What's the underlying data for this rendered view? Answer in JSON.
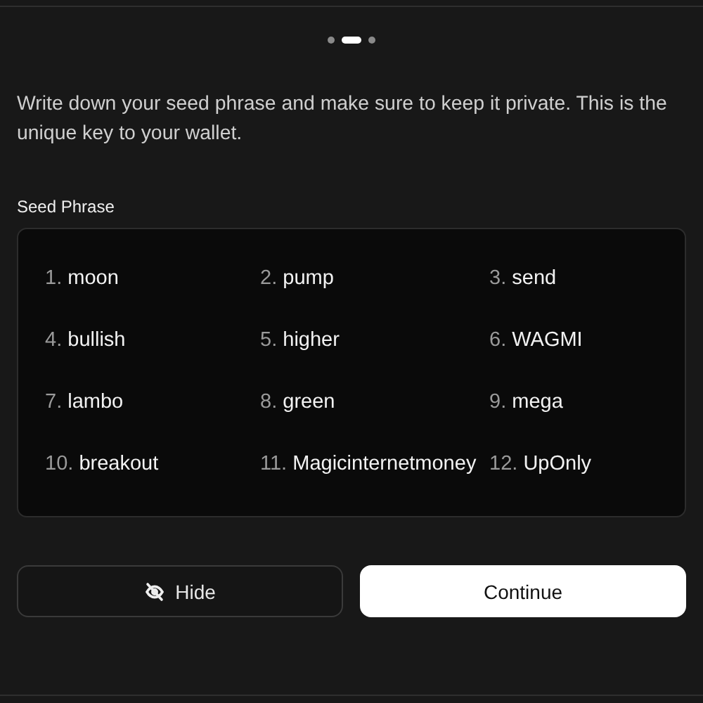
{
  "pager": [
    {
      "selected": false
    },
    {
      "selected": true
    },
    {
      "selected": false
    }
  ],
  "description": "Write down your seed phrase and make sure to keep it private. This is the unique key to your wallet.",
  "seed_phrase": {
    "label": "Seed Phrase",
    "words": [
      {
        "index": "1.",
        "word": "moon"
      },
      {
        "index": "2.",
        "word": "pump"
      },
      {
        "index": "3.",
        "word": "send"
      },
      {
        "index": "4.",
        "word": "bullish"
      },
      {
        "index": "5.",
        "word": "higher"
      },
      {
        "index": "6.",
        "word": "WAGMI"
      },
      {
        "index": "7.",
        "word": "lambo"
      },
      {
        "index": "8.",
        "word": "green"
      },
      {
        "index": "9.",
        "word": "mega"
      },
      {
        "index": "10.",
        "word": "breakout"
      },
      {
        "index": "11.",
        "word": "Magicinternetmoney"
      },
      {
        "index": "12.",
        "word": "UpOnly"
      }
    ]
  },
  "buttons": [
    {
      "kind": "secondary",
      "label": "Hide"
    },
    {
      "kind": "primary",
      "label": "Continue"
    }
  ]
}
